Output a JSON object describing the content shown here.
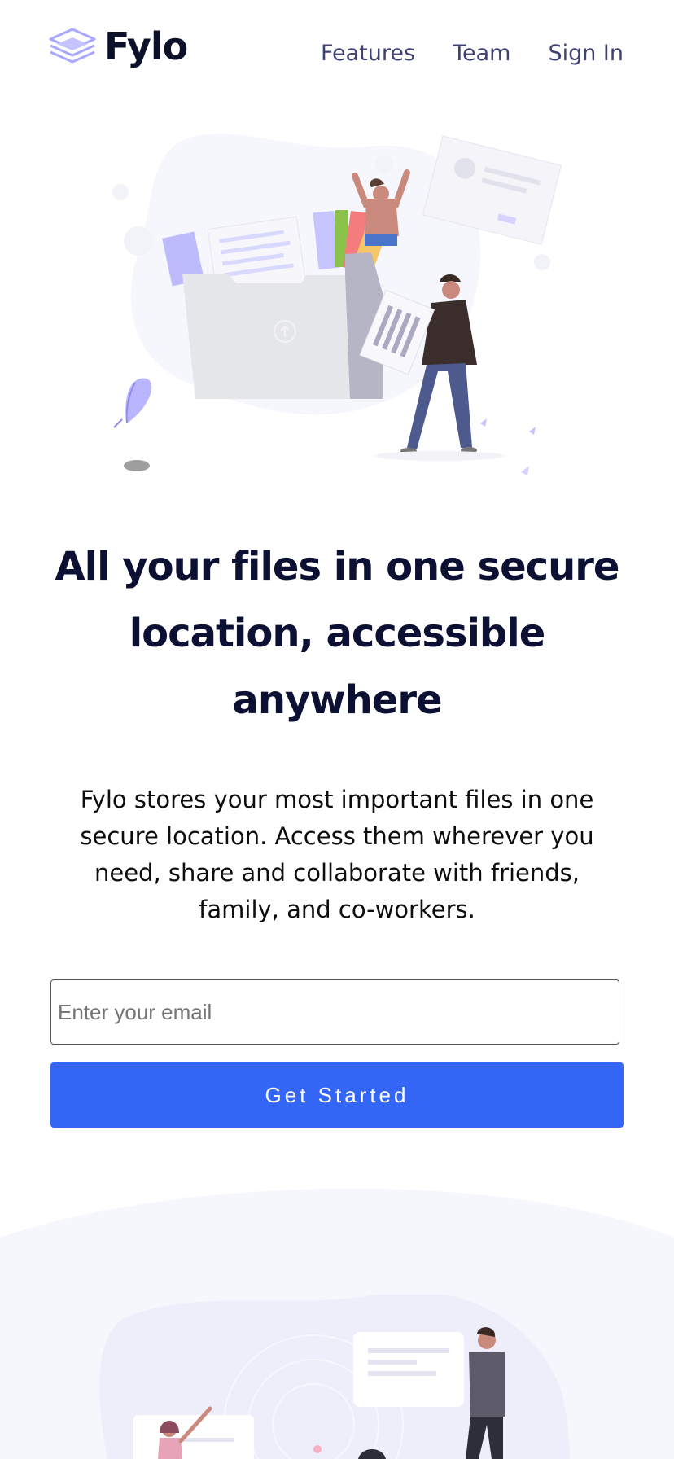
{
  "header": {
    "brand": "Fylo",
    "nav": [
      {
        "label": "Features"
      },
      {
        "label": "Team"
      },
      {
        "label": "Sign In"
      }
    ]
  },
  "hero": {
    "headline_line1": "All your files in one secure",
    "headline_line2": "location, accessible",
    "headline_line3": "anywhere",
    "description": "Fylo stores your most important files in one secure location. Access them wherever you need, share and collaborate with friends, family, and co-workers.",
    "email_placeholder": "Enter your email",
    "cta_label": "Get Started"
  },
  "colors": {
    "primary": "#3466f6",
    "heading": "#0c1033",
    "nav": "#3f4173",
    "accent_light": "#f6f6fd"
  }
}
